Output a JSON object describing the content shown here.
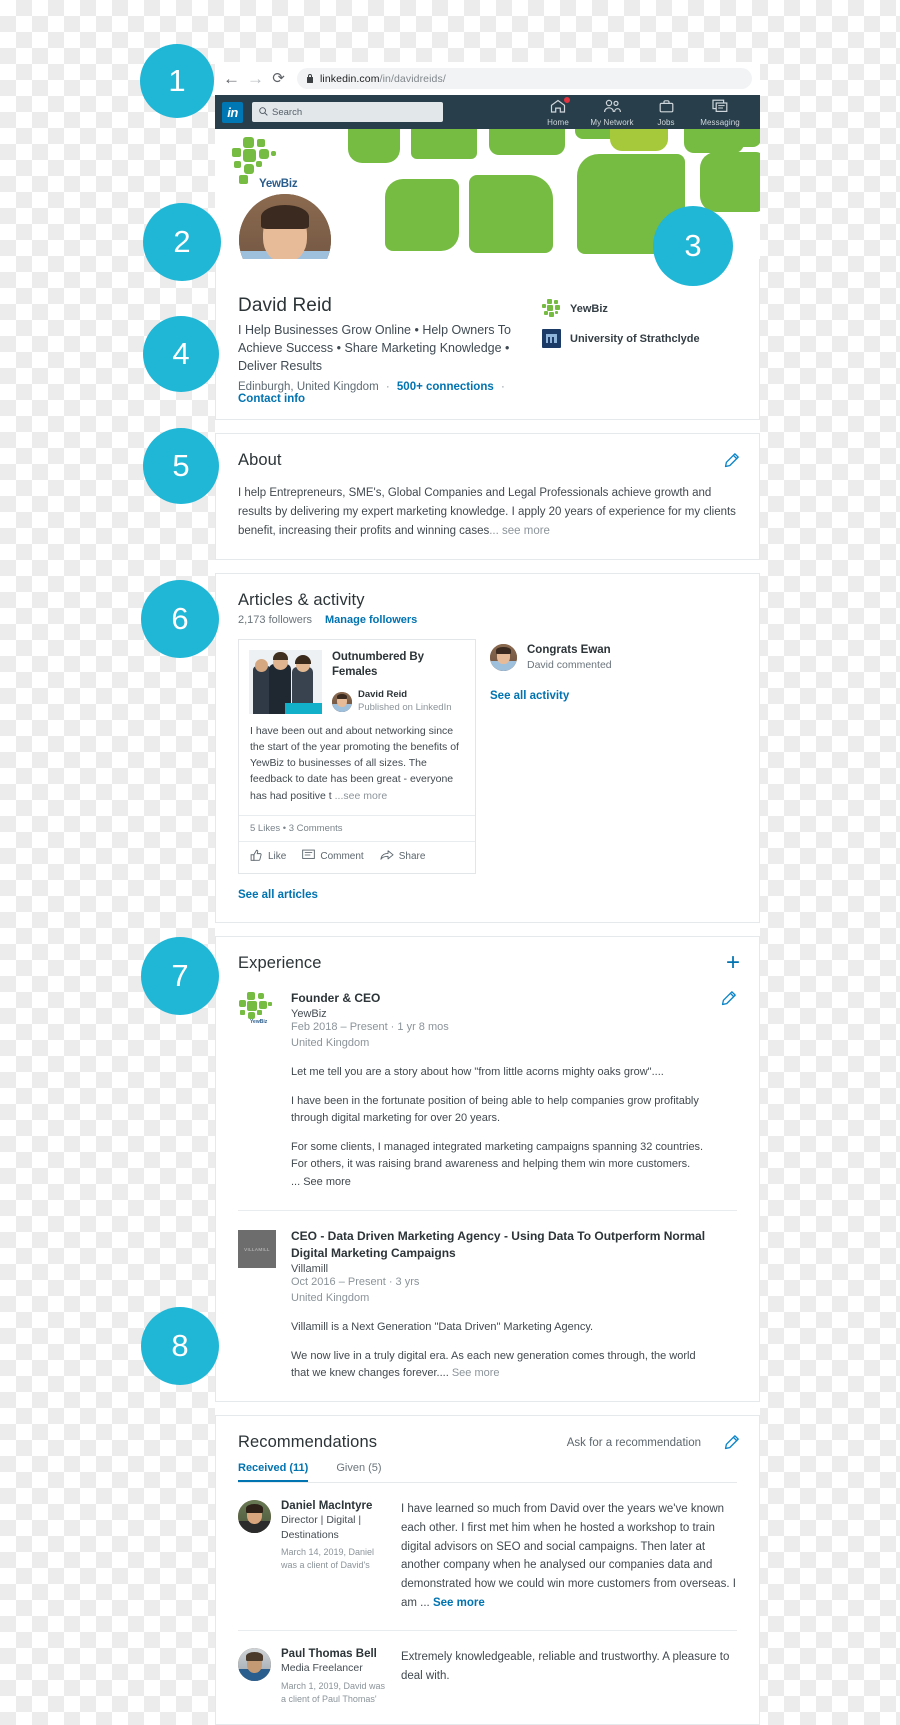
{
  "browser": {
    "back_icon": "←",
    "forward_icon": "→",
    "reload_icon": "⟳",
    "lock_icon": "🔒",
    "url_domain": "linkedin.com",
    "url_path": "/in/davidreids/"
  },
  "linkedin_nav": {
    "logo": "in",
    "search_placeholder": "Search",
    "items": [
      {
        "label": "Home",
        "icon": "home-icon",
        "badge": true
      },
      {
        "label": "My Network",
        "icon": "network-icon",
        "badge": false
      },
      {
        "label": "Jobs",
        "icon": "briefcase-icon",
        "badge": false
      },
      {
        "label": "Messaging",
        "icon": "messaging-icon",
        "badge": false
      }
    ]
  },
  "profile": {
    "banner_logo_text": "YewBiz",
    "name": "David Reid",
    "headline": "I Help Businesses Grow Online • Help Owners To Achieve Success • Share Marketing Knowledge • Deliver Results",
    "location": "Edinburgh, United Kingdom",
    "separator": "·",
    "connections": "500+ connections",
    "contact_info": "Contact info",
    "orgs": [
      {
        "name": "YewBiz",
        "logo": "yewbiz-logo"
      },
      {
        "name": "University of Strathclyde",
        "logo": "strathclyde-logo"
      }
    ]
  },
  "about": {
    "title": "About",
    "text": "I help Entrepreneurs, SME's, Global Companies and Legal Professionals achieve growth and results by delivering my expert marketing knowledge. I apply 20 years of experience for my clients benefit, increasing their profits and winning cases",
    "see_more": "... see more",
    "edit_icon": "pencil-icon"
  },
  "articles_activity": {
    "title": "Articles & activity",
    "followers": "2,173 followers",
    "manage_followers": "Manage followers",
    "article": {
      "title": "Outnumbered By Females",
      "author": "David Reid",
      "published": "Published on LinkedIn",
      "body": "I have been out and about networking since the start of the year promoting the benefits of YewBiz to businesses of all sizes. The feedback to date has been great - everyone has had positive t",
      "see_more": "...see more",
      "stats": "5 Likes  •  3 Comments",
      "actions": [
        {
          "label": "Like",
          "icon": "thumbs-up-icon"
        },
        {
          "label": "Comment",
          "icon": "comment-icon"
        },
        {
          "label": "Share",
          "icon": "share-icon"
        }
      ]
    },
    "activity": {
      "title": "Congrats Ewan",
      "subtitle": "David commented",
      "see_all": "See all activity"
    },
    "see_all_articles": "See all articles"
  },
  "experience": {
    "title": "Experience",
    "add_icon": "plus-icon",
    "items": [
      {
        "title": "Founder & CEO",
        "company": "YewBiz",
        "date": "Feb 2018 – Present · 1 yr 8 mos",
        "location": "United Kingdom",
        "logo": "yewbiz-logo",
        "paragraphs": [
          "Let me tell you are a story about how \"from little acorns mighty oaks grow\"....",
          "I have been in the fortunate position of being able to help companies grow profitably through digital marketing for over 20 years.",
          "For some clients, I managed integrated marketing campaigns spanning 32 countries. For others, it was raising brand awareness and helping them win more customers."
        ],
        "see_more": "... See more"
      },
      {
        "title": "CEO - Data Driven Marketing Agency - Using Data To Outperform Normal Digital Marketing Campaigns",
        "company": "Villamill",
        "date": "Oct 2016 – Present · 3 yrs",
        "location": "United Kingdom",
        "logo": "villamill-logo",
        "logo_text": "VILLAMILL",
        "paragraphs": [
          "Villamill is a Next Generation \"Data Driven\" Marketing Agency.",
          "We now live in a truly digital era. As each new generation comes through, the world that we knew changes forever...."
        ],
        "see_more": "See more"
      }
    ]
  },
  "recommendations": {
    "title": "Recommendations",
    "ask": "Ask for a recommendation",
    "edit_icon": "pencil-icon",
    "tabs": [
      {
        "label": "Received (11)",
        "active": true
      },
      {
        "label": "Given (5)",
        "active": false
      }
    ],
    "items": [
      {
        "name": "Daniel MacIntyre",
        "role": "Director | Digital | Destinations",
        "date": "March 14, 2019, Daniel was a client of David's",
        "text": "I have learned so much from David over the years we've known each other. I first met him when he hosted a workshop to train digital advisors on SEO and social campaigns. Then later at another company when he analysed our companies data and demonstrated how we could win more customers from overseas. I am ...",
        "see_more": "See more"
      },
      {
        "name": "Paul Thomas Bell",
        "role": "Media Freelancer",
        "date": "March 1, 2019, David was a client of Paul Thomas'",
        "text": "Extremely knowledgeable, reliable and trustworthy. A pleasure to deal with.",
        "see_more": ""
      }
    ]
  },
  "callouts": [
    {
      "number": "1"
    },
    {
      "number": "2"
    },
    {
      "number": "3"
    },
    {
      "number": "4"
    },
    {
      "number": "5"
    },
    {
      "number": "6"
    },
    {
      "number": "7"
    },
    {
      "number": "8"
    }
  ],
  "colors": {
    "callout": "#20b6d6",
    "linkedin_nav": "#283e4a",
    "linkedin_blue": "#0073b1",
    "brand_green": "#76bc43"
  }
}
